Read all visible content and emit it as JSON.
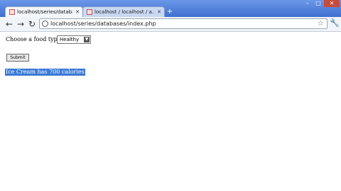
{
  "tabs": [
    {
      "title": "localhost/series/database...",
      "active": true
    },
    {
      "title": "localhost / localhost / a...",
      "active": false
    }
  ],
  "toolbar": {
    "url": "localhost/series/databases/index.php"
  },
  "form": {
    "label": "Choose a food type:",
    "selected": "Healthy",
    "submit_label": "Submit"
  },
  "result": {
    "text": "Ice Cream has 700 calories"
  }
}
